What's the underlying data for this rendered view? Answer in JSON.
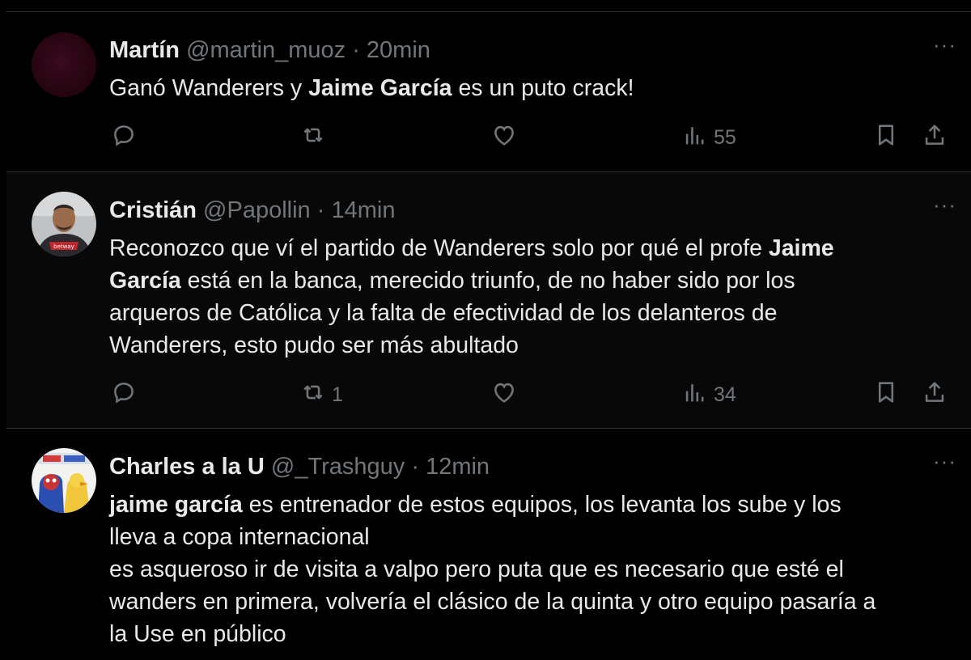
{
  "tweets": [
    {
      "name": "Martín",
      "handle": "@martin_muoz",
      "sep": "·",
      "time": "20min",
      "more": "···",
      "body_lines": [
        [
          {
            "t": "Ganó Wanderers y "
          },
          {
            "t": "Jaime García",
            "b": true
          },
          {
            "t": " es un puto crack!"
          }
        ]
      ],
      "replies": "",
      "retweets": "",
      "likes": "",
      "views": "55",
      "avatar": "dark-red-avatar"
    },
    {
      "name": "Cristián",
      "handle": "@Papollin",
      "sep": "·",
      "time": "14min",
      "more": "···",
      "body_lines": [
        [
          {
            "t": "Reconozco que ví el partido de Wanderers solo por qué el profe "
          },
          {
            "t": "Jaime",
            "b": true
          }
        ],
        [
          {
            "t": "García",
            "b": true
          },
          {
            "t": " está en la banca, merecido triunfo, de no haber sido por los"
          }
        ],
        [
          {
            "t": "arqueros de Católica y la falta de efectividad de los delanteros de"
          }
        ],
        [
          {
            "t": "Wanderers, esto pudo ser más abultado"
          }
        ]
      ],
      "replies": "",
      "retweets": "1",
      "likes": "",
      "views": "34",
      "avatar": "man-photo-avatar"
    },
    {
      "name": "Charles a la U",
      "handle": "@_Trashguy",
      "sep": "·",
      "time": "12min",
      "more": "···",
      "body_lines": [
        [
          {
            "t": "jaime garcía",
            "b": true
          },
          {
            "t": " es entrenador de estos equipos, los levanta los sube y los"
          }
        ],
        [
          {
            "t": "lleva a copa internacional"
          }
        ],
        [
          {
            "t": "es asqueroso ir de visita a valpo pero puta que es necesario que esté el"
          }
        ],
        [
          {
            "t": "wanders en primera, volvería el clásico de la quinta y otro equipo pasaría a"
          }
        ],
        [
          {
            "t": "la Use en público"
          }
        ]
      ],
      "avatar": "cartoon-avatar"
    }
  ],
  "icons": {
    "reply": "reply-icon",
    "retweet": "retweet-icon",
    "like": "heart-icon",
    "views": "views-icon",
    "bookmark": "bookmark-icon",
    "share": "share-icon"
  },
  "colors": {
    "background": "#000000",
    "text": "#e7e9ea",
    "muted": "#71767b",
    "divider": "#2f3336"
  }
}
